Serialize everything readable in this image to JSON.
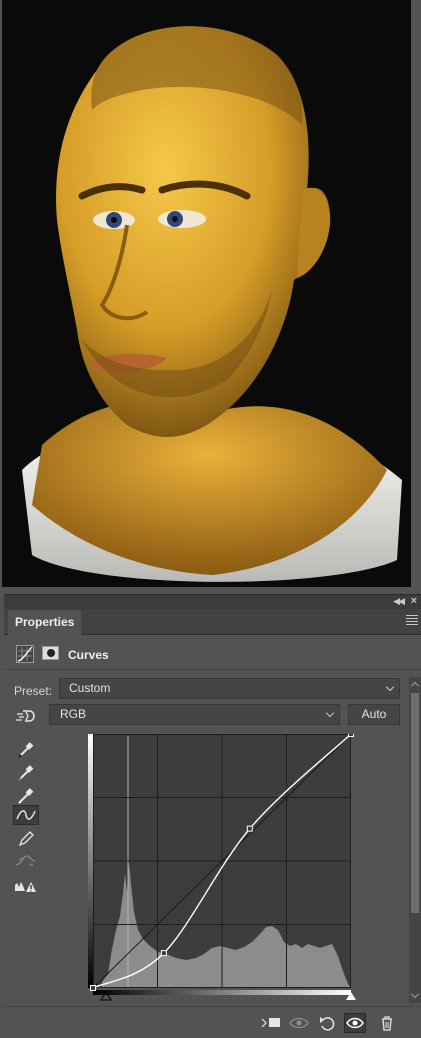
{
  "canvas": {
    "subject": "portrait-render"
  },
  "panel": {
    "tab_label": "Properties",
    "title": "Curves",
    "preset_label": "Preset:",
    "preset_value": "Custom",
    "channel_value": "RGB",
    "auto_label": "Auto",
    "tools": [
      "eyedropper-black-icon",
      "eyedropper-gray-icon",
      "eyedropper-white-icon",
      "curve-edit-icon",
      "pencil-icon",
      "smooth-icon",
      "clipping-warning-icon"
    ],
    "bottom_icons": [
      "clip-to-layer-icon",
      "view-previous-icon",
      "reset-icon",
      "visibility-eye-icon",
      "trash-icon"
    ]
  },
  "curve": {
    "input_range": [
      0,
      255
    ],
    "output_range": [
      0,
      255
    ],
    "points": [
      [
        0,
        0
      ],
      [
        70,
        35
      ],
      [
        155,
        160
      ],
      [
        255,
        255
      ]
    ]
  },
  "colors": {
    "panel_bg": "#535353",
    "dark_bg": "#424242",
    "text": "#e3e3e3",
    "skin": "#d9a23a"
  }
}
